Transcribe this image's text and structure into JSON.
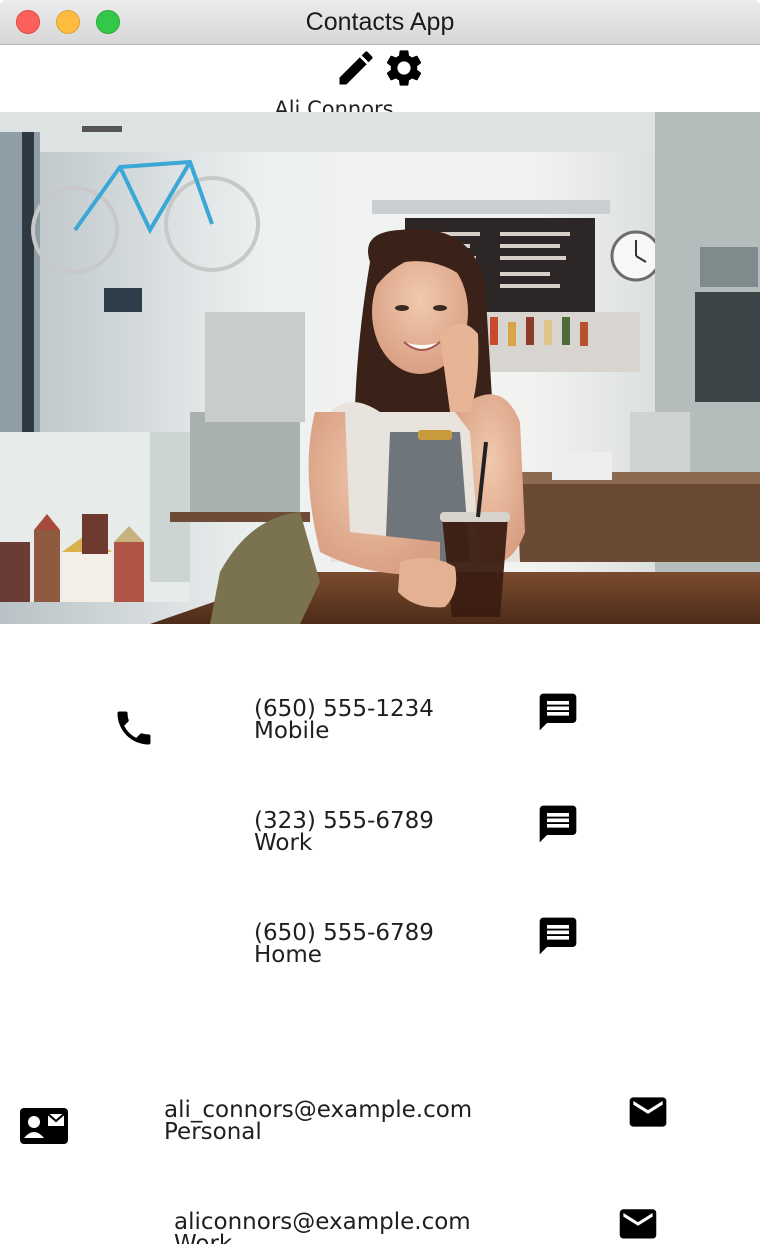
{
  "window": {
    "title": "Contacts App"
  },
  "toolbar": {
    "edit_icon": "pencil-icon",
    "settings_icon": "gear-icon"
  },
  "contact": {
    "name": "Ali Connors",
    "photo": "woman-in-cafe-photo"
  },
  "phones": [
    {
      "number": "(650) 555-1234",
      "label": "Mobile",
      "action_icon": "message-icon"
    },
    {
      "number": "(323) 555-6789",
      "label": "Work",
      "action_icon": "message-icon"
    },
    {
      "number": "(650) 555-6789",
      "label": "Home",
      "action_icon": "message-icon"
    }
  ],
  "emails": [
    {
      "address": "ali_connors@example.com",
      "label": "Personal",
      "action_icon": "mail-icon"
    },
    {
      "address": "aliconnors@example.com",
      "label": "Work",
      "action_icon": "mail-icon"
    }
  ],
  "section_icons": {
    "phone": "phone-icon",
    "email": "contact-mail-icon"
  }
}
